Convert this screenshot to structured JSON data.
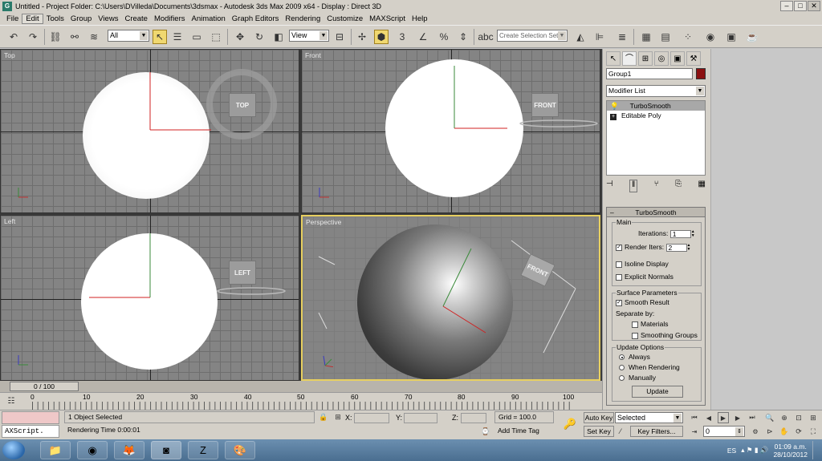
{
  "titlebar": {
    "title": "Untitled    - Project Folder: C:\\Users\\DVilleda\\Documents\\3dsmax    - Autodesk 3ds Max  2009 x64    - Display : Direct 3D"
  },
  "menu": [
    "File",
    "Edit",
    "Tools",
    "Group",
    "Views",
    "Create",
    "Modifiers",
    "Animation",
    "Graph Editors",
    "Rendering",
    "Customize",
    "MAXScript",
    "Help"
  ],
  "toolbar": {
    "selection_filter": "All",
    "ref_coord": "View",
    "named_selection_placeholder": "Create Selection Set"
  },
  "viewports": {
    "top": {
      "label": "Top",
      "cube_label": "TOP"
    },
    "front": {
      "label": "Front",
      "cube_label": "FRONT"
    },
    "left": {
      "label": "Left",
      "cube_label": "LEFT"
    },
    "perspective": {
      "label": "Perspective",
      "cube_label": "FRONT"
    }
  },
  "timeline": {
    "slider_label": "0 / 100",
    "ticks": [
      "0",
      "10",
      "20",
      "30",
      "40",
      "50",
      "60",
      "70",
      "80",
      "90",
      "100"
    ]
  },
  "cmdpanel": {
    "object_name": "Group1",
    "object_color": "#8b1010",
    "modifier_list": "Modifier List",
    "stack": [
      "TurboSmooth",
      "Editable Poly"
    ],
    "rollout_title": "TurboSmooth",
    "main_group": "Main",
    "iterations_label": "Iterations:",
    "iterations_value": "1",
    "render_iters_label": "Render Iters:",
    "render_iters_value": "2",
    "render_iters_checked": true,
    "isoline_label": "Isoline Display",
    "explicit_normals_label": "Explicit Normals",
    "surface_group": "Surface Parameters",
    "smooth_result_label": "Smooth Result",
    "smooth_result_checked": true,
    "separate_by": "Separate by:",
    "materials_label": "Materials",
    "smoothing_groups_label": "Smoothing Groups",
    "update_group": "Update Options",
    "update_always": "Always",
    "update_when_rendering": "When Rendering",
    "update_manually": "Manually",
    "update_button": "Update"
  },
  "status": {
    "maxscript_label": "AXScript.",
    "selection": "1 Object Selected",
    "render_time": "Rendering Time  0:00:01",
    "x_label": "X:",
    "y_label": "Y:",
    "z_label": "Z:",
    "grid": "Grid = 100.0",
    "add_time_tag": "Add Time Tag",
    "auto_key": "Auto Key",
    "set_key": "Set Key",
    "key_mode": "Selected",
    "key_filters": "Key Filters...",
    "frame": "0"
  },
  "taskbar": {
    "language": "ES",
    "time": "01:09 a.m.",
    "date": "28/10/2012"
  }
}
